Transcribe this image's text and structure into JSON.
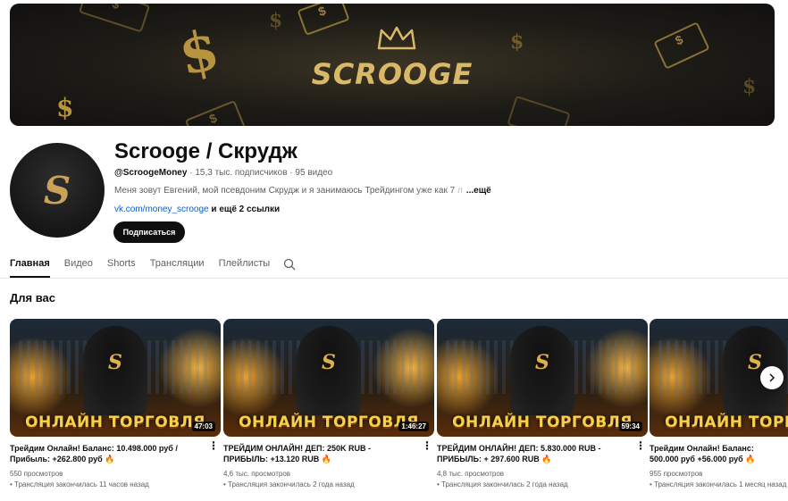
{
  "banner": {
    "brand": "SCROOGE"
  },
  "channel": {
    "name": "Scrooge / Скрудж",
    "handle": "@ScroogeMoney",
    "meta_rest": " · 15,3 тыс. подписчиков · 95 видео",
    "description": "Меня зовут Евгений, мой псевдоним Скрудж и я занимаюсь Трейдингом уже как 7",
    "description_fade": " л",
    "more_label": "...ещё",
    "link": "vk.com/money_scrooge",
    "link_extra": " и ещё 2 ссылки",
    "subscribe_label": "Подписаться"
  },
  "tabs": [
    {
      "label": "Главная",
      "active": true
    },
    {
      "label": "Видео"
    },
    {
      "label": "Shorts"
    },
    {
      "label": "Трансляции"
    },
    {
      "label": "Плейлисты"
    }
  ],
  "section": {
    "title": "Для вас"
  },
  "videos": [
    {
      "thumb_text": "ОНЛАЙН ТОРГОВЛЯ",
      "duration": "47:03",
      "title": "Трейдим Онлайн! Баланс: 10.498.000 руб / Прибыль: +262.800 руб",
      "views": "550 просмотров",
      "status": "• Трансляция закончилась 11 часов назад"
    },
    {
      "thumb_text": "ОНЛАЙН ТОРГОВЛЯ",
      "duration": "1:46:27",
      "title": "ТРЕЙДИМ ОНЛАЙН! ДЕП: 250K RUB - ПРИБЫЛЬ: +13.120 RUB",
      "views": "4,6 тыс. просмотров",
      "status": "• Трансляция закончилась 2 года назад"
    },
    {
      "thumb_text": "ОНЛАЙН ТОРГОВЛЯ",
      "duration": "59:34",
      "title": "ТРЕЙДИМ ОНЛАЙН! ДЕП: 5.830.000 RUB - ПРИБЫЛЬ: + 297.600 RUB",
      "views": "4,8 тыс. просмотров",
      "status": "• Трансляция закончилась 2 года назад"
    },
    {
      "thumb_text": "ОНЛАЙН ТОРГОВЛЯ",
      "duration": "",
      "title": "Трейдим Онлайн! Баланс: 500.000 руб +56.000 руб",
      "views": "955 просмотров",
      "status": "• Трансляция закончилась 1 месяц назад"
    }
  ]
}
